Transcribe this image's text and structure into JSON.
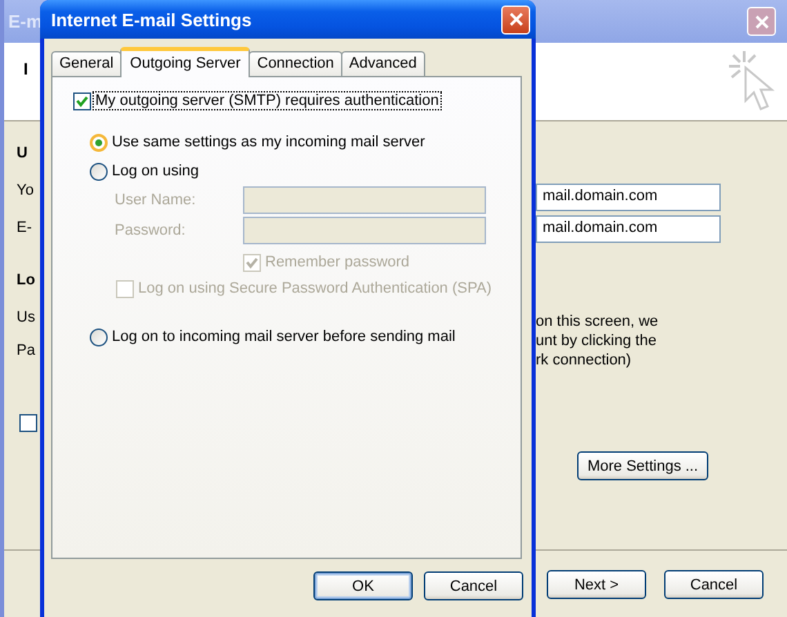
{
  "background_window": {
    "title": "E-m",
    "header_text": "I",
    "left_labels": [
      {
        "kind": "heading",
        "text": "U"
      },
      {
        "kind": "label",
        "text": "Yo"
      },
      {
        "kind": "label",
        "text": "E-"
      },
      {
        "kind": "heading",
        "text": "Lo"
      },
      {
        "kind": "label",
        "text": "Us"
      },
      {
        "kind": "label",
        "text": "Pa"
      }
    ],
    "left_checkbox": {
      "checked": false
    },
    "fields": [
      {
        "value": "mail.domain.com"
      },
      {
        "value": "mail.domain.com"
      }
    ],
    "description_lines": [
      "on this screen, we",
      "unt by clicking the",
      "rk connection)"
    ],
    "more_settings_button": "More Settings ...",
    "buttons": [
      "Next >",
      "Cancel"
    ]
  },
  "dialog": {
    "title": "Internet E-mail Settings",
    "tabs": [
      {
        "label": "General",
        "selected": false
      },
      {
        "label": "Outgoing Server",
        "selected": true
      },
      {
        "label": "Connection",
        "selected": false
      },
      {
        "label": "Advanced",
        "selected": false
      }
    ],
    "auth_checkbox": {
      "label": "My outgoing server (SMTP) requires authentication",
      "checked": true
    },
    "options": [
      {
        "label": "Use same settings as my incoming mail server",
        "selected": true
      },
      {
        "label": "Log on using",
        "selected": false,
        "credentials": [
          {
            "label": "User Name:",
            "disabled": true
          },
          {
            "label": "Password:",
            "disabled": true
          }
        ],
        "checkboxes": [
          {
            "label": "Remember password",
            "checked": true,
            "disabled": true
          },
          {
            "label": "Log on using Secure Password Authentication (SPA)",
            "checked": false,
            "disabled": true
          }
        ]
      },
      {
        "label": "Log on to incoming mail server before sending mail",
        "selected": false
      }
    ],
    "buttons": [
      "OK",
      "Cancel"
    ]
  }
}
